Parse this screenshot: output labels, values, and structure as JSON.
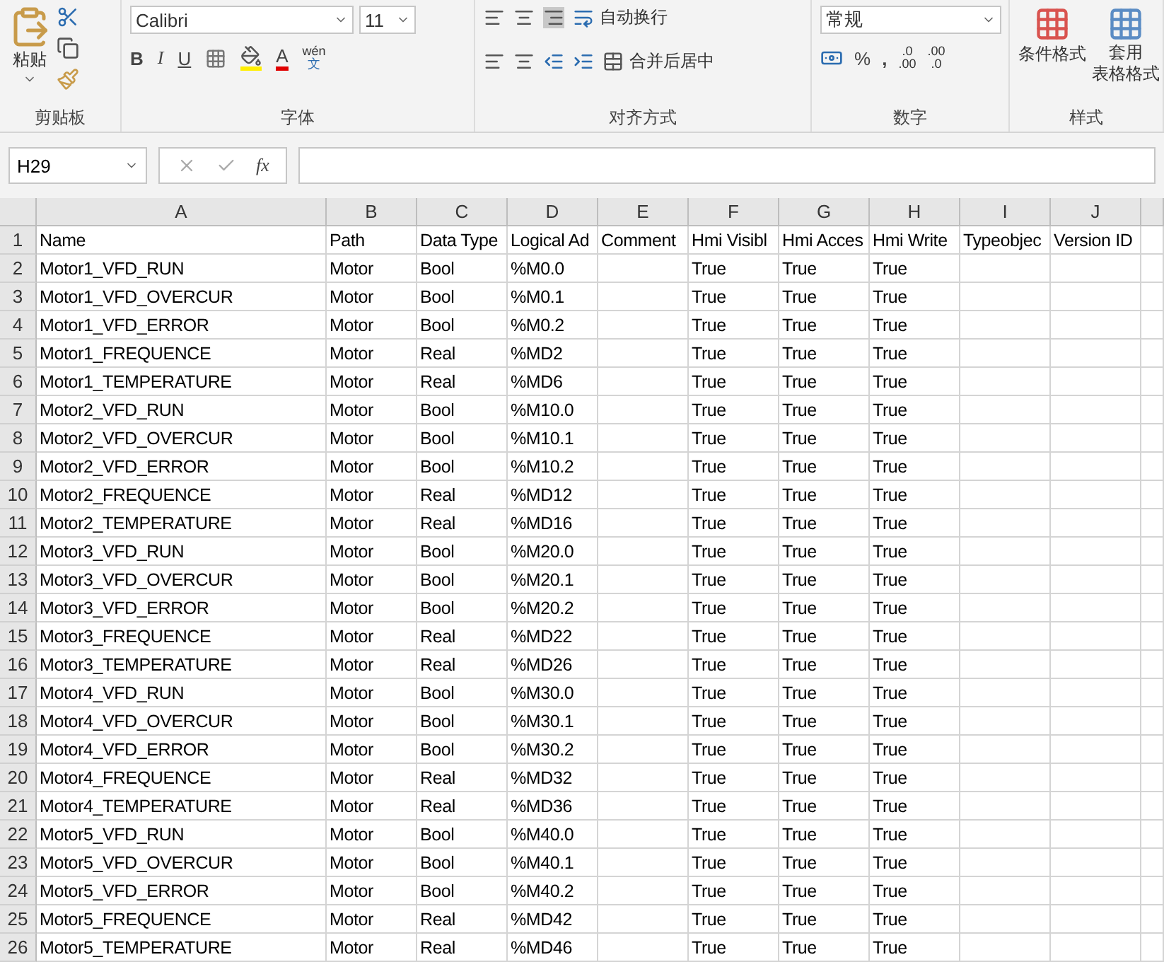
{
  "ribbon": {
    "clipboard": {
      "paste": "粘贴",
      "group": "剪贴板"
    },
    "font": {
      "name": "Calibri",
      "size": "11",
      "bold": "B",
      "italic": "I",
      "underline": "U",
      "phonetic_top": "wén",
      "phonetic_bottom": "文",
      "font_color_letter": "A",
      "group": "字体"
    },
    "alignment": {
      "wrap": "自动换行",
      "merge": "合并后居中",
      "group": "对齐方式"
    },
    "number": {
      "format": "常规",
      "percent": "%",
      "comma": ",",
      "increase_decimal": [
        ".0",
        ".00"
      ],
      "decrease_decimal": [
        ".00",
        ".0"
      ],
      "group": "数字"
    },
    "styles": {
      "conditional": "条件格式",
      "table_lines": [
        "套用",
        "表格格式"
      ],
      "group": "样式"
    }
  },
  "formula_bar": {
    "name_box": "H29",
    "fx": "fx"
  },
  "columns": [
    "A",
    "B",
    "C",
    "D",
    "E",
    "F",
    "G",
    "H",
    "I",
    "J"
  ],
  "rows": [
    {
      "number": "1",
      "cells": {
        "A": "Name",
        "B": "Path",
        "C": "Data Type",
        "D": "Logical Ad",
        "E": "Comment",
        "F": "Hmi Visibl",
        "G": "Hmi Acces",
        "H": "Hmi Write",
        "I": "Typeobjec",
        "J": "Version ID"
      }
    },
    {
      "number": "2",
      "cells": {
        "A": "Motor1_VFD_RUN",
        "B": "Motor",
        "C": "Bool",
        "D": "%M0.0",
        "F": "True",
        "G": "True",
        "H": "True"
      }
    },
    {
      "number": "3",
      "cells": {
        "A": "Motor1_VFD_OVERCUR",
        "B": "Motor",
        "C": "Bool",
        "D": "%M0.1",
        "F": "True",
        "G": "True",
        "H": "True"
      }
    },
    {
      "number": "4",
      "cells": {
        "A": "Motor1_VFD_ERROR",
        "B": "Motor",
        "C": "Bool",
        "D": "%M0.2",
        "F": "True",
        "G": "True",
        "H": "True"
      }
    },
    {
      "number": "5",
      "cells": {
        "A": "Motor1_FREQUENCE",
        "B": "Motor",
        "C": "Real",
        "D": "%MD2",
        "F": "True",
        "G": "True",
        "H": "True"
      }
    },
    {
      "number": "6",
      "cells": {
        "A": "Motor1_TEMPERATURE",
        "B": "Motor",
        "C": "Real",
        "D": "%MD6",
        "F": "True",
        "G": "True",
        "H": "True"
      }
    },
    {
      "number": "7",
      "cells": {
        "A": "Motor2_VFD_RUN",
        "B": "Motor",
        "C": "Bool",
        "D": "%M10.0",
        "F": "True",
        "G": "True",
        "H": "True"
      }
    },
    {
      "number": "8",
      "cells": {
        "A": "Motor2_VFD_OVERCUR",
        "B": "Motor",
        "C": "Bool",
        "D": "%M10.1",
        "F": "True",
        "G": "True",
        "H": "True"
      }
    },
    {
      "number": "9",
      "cells": {
        "A": "Motor2_VFD_ERROR",
        "B": "Motor",
        "C": "Bool",
        "D": "%M10.2",
        "F": "True",
        "G": "True",
        "H": "True"
      }
    },
    {
      "number": "10",
      "cells": {
        "A": "Motor2_FREQUENCE",
        "B": "Motor",
        "C": "Real",
        "D": "%MD12",
        "F": "True",
        "G": "True",
        "H": "True"
      }
    },
    {
      "number": "11",
      "cells": {
        "A": "Motor2_TEMPERATURE",
        "B": "Motor",
        "C": "Real",
        "D": "%MD16",
        "F": "True",
        "G": "True",
        "H": "True"
      }
    },
    {
      "number": "12",
      "cells": {
        "A": "Motor3_VFD_RUN",
        "B": "Motor",
        "C": "Bool",
        "D": "%M20.0",
        "F": "True",
        "G": "True",
        "H": "True"
      }
    },
    {
      "number": "13",
      "cells": {
        "A": "Motor3_VFD_OVERCUR",
        "B": "Motor",
        "C": "Bool",
        "D": "%M20.1",
        "F": "True",
        "G": "True",
        "H": "True"
      }
    },
    {
      "number": "14",
      "cells": {
        "A": "Motor3_VFD_ERROR",
        "B": "Motor",
        "C": "Bool",
        "D": "%M20.2",
        "F": "True",
        "G": "True",
        "H": "True"
      }
    },
    {
      "number": "15",
      "cells": {
        "A": "Motor3_FREQUENCE",
        "B": "Motor",
        "C": "Real",
        "D": "%MD22",
        "F": "True",
        "G": "True",
        "H": "True"
      }
    },
    {
      "number": "16",
      "cells": {
        "A": "Motor3_TEMPERATURE",
        "B": "Motor",
        "C": "Real",
        "D": "%MD26",
        "F": "True",
        "G": "True",
        "H": "True"
      }
    },
    {
      "number": "17",
      "cells": {
        "A": "Motor4_VFD_RUN",
        "B": "Motor",
        "C": "Bool",
        "D": "%M30.0",
        "F": "True",
        "G": "True",
        "H": "True"
      }
    },
    {
      "number": "18",
      "cells": {
        "A": "Motor4_VFD_OVERCUR",
        "B": "Motor",
        "C": "Bool",
        "D": "%M30.1",
        "F": "True",
        "G": "True",
        "H": "True"
      }
    },
    {
      "number": "19",
      "cells": {
        "A": "Motor4_VFD_ERROR",
        "B": "Motor",
        "C": "Bool",
        "D": "%M30.2",
        "F": "True",
        "G": "True",
        "H": "True"
      }
    },
    {
      "number": "20",
      "cells": {
        "A": "Motor4_FREQUENCE",
        "B": "Motor",
        "C": "Real",
        "D": "%MD32",
        "F": "True",
        "G": "True",
        "H": "True"
      }
    },
    {
      "number": "21",
      "cells": {
        "A": "Motor4_TEMPERATURE",
        "B": "Motor",
        "C": "Real",
        "D": "%MD36",
        "F": "True",
        "G": "True",
        "H": "True"
      }
    },
    {
      "number": "22",
      "cells": {
        "A": "Motor5_VFD_RUN",
        "B": "Motor",
        "C": "Bool",
        "D": "%M40.0",
        "F": "True",
        "G": "True",
        "H": "True"
      }
    },
    {
      "number": "23",
      "cells": {
        "A": "Motor5_VFD_OVERCUR",
        "B": "Motor",
        "C": "Bool",
        "D": "%M40.1",
        "F": "True",
        "G": "True",
        "H": "True"
      }
    },
    {
      "number": "24",
      "cells": {
        "A": "Motor5_VFD_ERROR",
        "B": "Motor",
        "C": "Bool",
        "D": "%M40.2",
        "F": "True",
        "G": "True",
        "H": "True"
      }
    },
    {
      "number": "25",
      "cells": {
        "A": "Motor5_FREQUENCE",
        "B": "Motor",
        "C": "Real",
        "D": "%MD42",
        "F": "True",
        "G": "True",
        "H": "True"
      }
    },
    {
      "number": "26",
      "cells": {
        "A": "Motor5_TEMPERATURE",
        "B": "Motor",
        "C": "Real",
        "D": "%MD46",
        "F": "True",
        "G": "True",
        "H": "True"
      }
    }
  ]
}
